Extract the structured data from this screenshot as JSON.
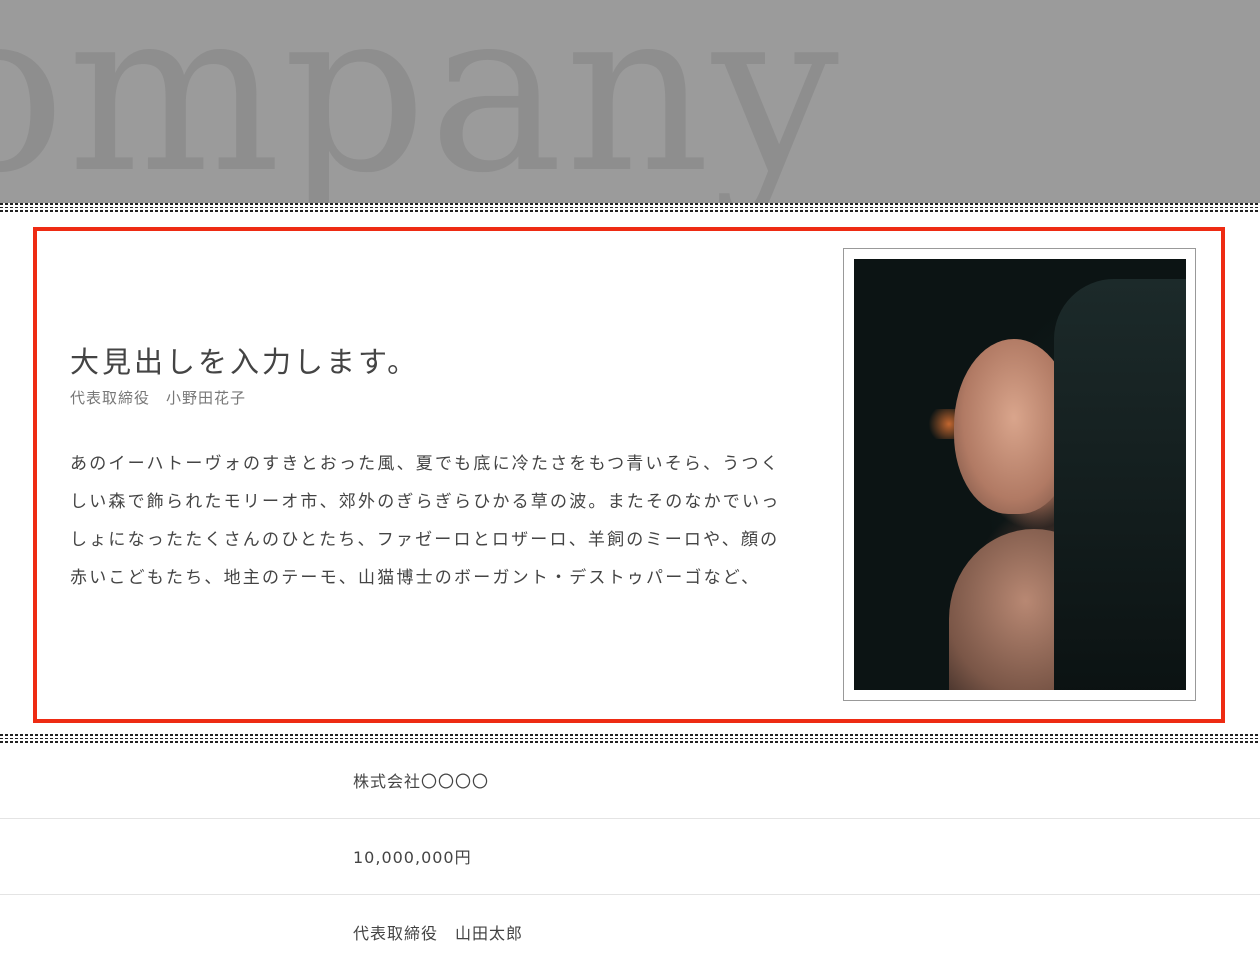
{
  "hero": {
    "background_word": "ompany",
    "background_color": "#9b9b9b"
  },
  "feature": {
    "border_color": "#ee2b13",
    "heading": "大見出しを入力します。",
    "subheading": "代表取締役　小野田花子",
    "body_lines": [
      "あのイーハトーヴォのすきとおった風、夏でも底に冷たさをもつ青いそら、うつく",
      "しい森で飾られたモリーオ市、郊外のぎらぎらひかる草の波。またそのなかでいっ",
      "しょになったたくさんのひとたち、ファゼーロとロザーロ、羊飼のミーロや、顔の",
      "赤いこどもたち、地主のテーモ、山猫博士のボーガント・デストゥパーゴなど、"
    ]
  },
  "company_info": {
    "rows": [
      {
        "value": "株式会社〇〇〇〇"
      },
      {
        "value": "10,000,000円"
      },
      {
        "value": "代表取締役　山田太郎"
      }
    ]
  }
}
